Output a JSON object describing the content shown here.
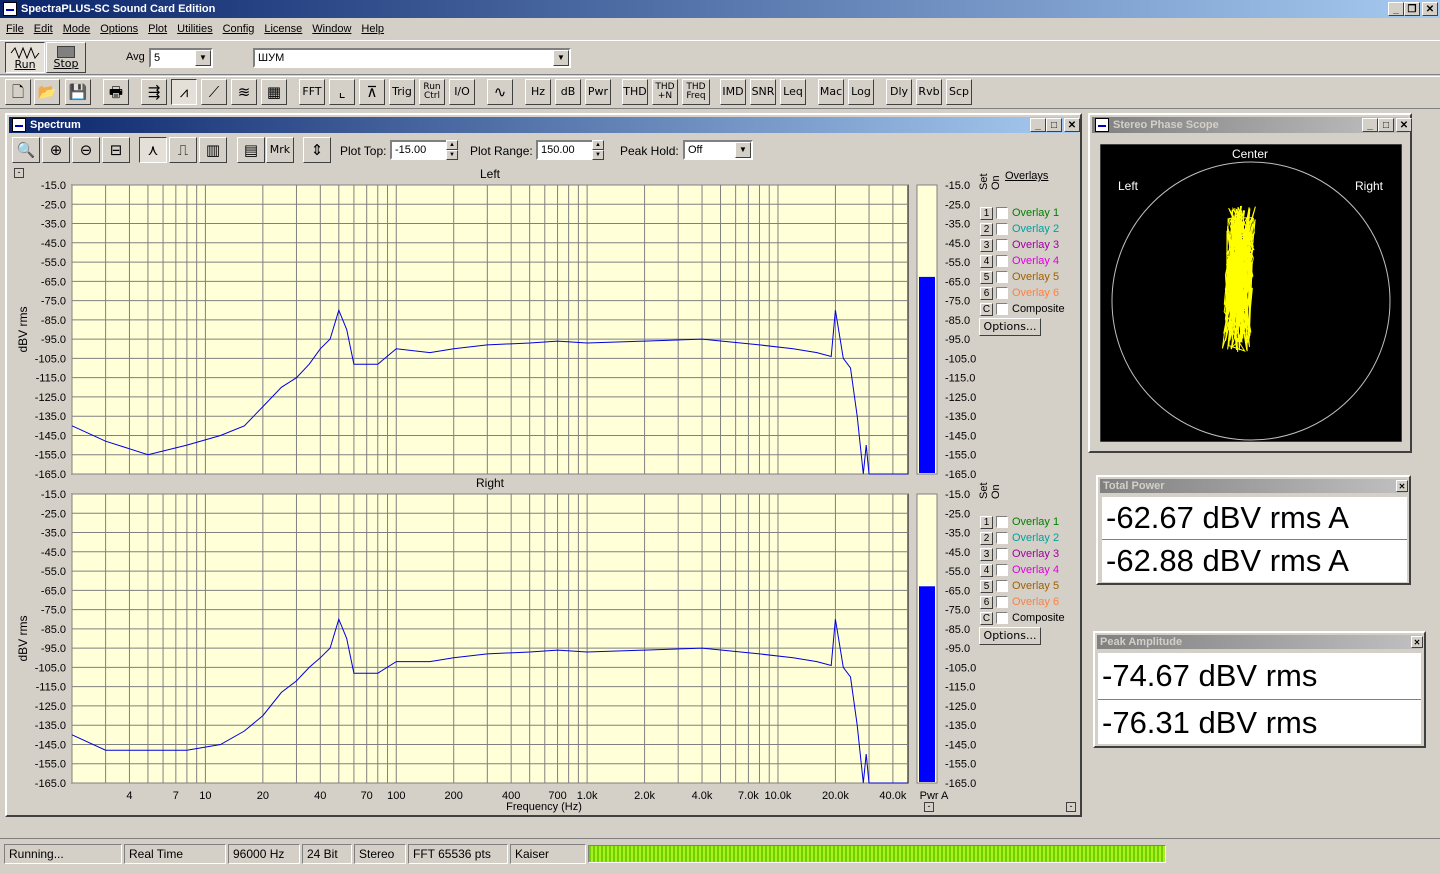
{
  "window": {
    "title": "SpectraPLUS-SC Sound Card Edition"
  },
  "menu": [
    "File",
    "Edit",
    "Mode",
    "Options",
    "Plot",
    "Utilities",
    "Config",
    "License",
    "Window",
    "Help"
  ],
  "toolbar1": {
    "run_label": "Run",
    "stop_label": "Stop",
    "avg_label": "Avg",
    "avg_value": "5",
    "preset_value": "ШУМ"
  },
  "toolbar2": {
    "fft": "FFT",
    "trig": "Trig",
    "run_ctrl_1": "Run",
    "run_ctrl_2": "Ctrl",
    "io": "I/O",
    "hz": "Hz",
    "db": "dB",
    "pwr": "Pwr",
    "thd": "THD",
    "thdn_1": "THD",
    "thdn_2": "+N",
    "thdf_1": "THD",
    "thdf_2": "Freq",
    "imd": "IMD",
    "snr": "SNR",
    "leq": "Leq",
    "mac": "Mac",
    "log": "Log",
    "dly": "Dly",
    "rvb": "Rvb",
    "scp": "Scp"
  },
  "spectrum": {
    "title": "Spectrum",
    "mrk": "Mrk",
    "plot_top_label": "Plot Top:",
    "plot_top_value": "-15.00",
    "plot_range_label": "Plot Range:",
    "plot_range_value": "150.00",
    "peak_hold_label": "Peak Hold:",
    "peak_hold_value": "Off",
    "left_title": "Left",
    "right_title": "Right",
    "ylabel": "dBV rms",
    "xlabel": "Frequency (Hz)",
    "pwr_a": "Pwr A",
    "y_ticks": [
      "-15.0",
      "-25.0",
      "-35.0",
      "-45.0",
      "-55.0",
      "-65.0",
      "-75.0",
      "-85.0",
      "-95.0",
      "-105.0",
      "-115.0",
      "-125.0",
      "-135.0",
      "-145.0",
      "-155.0",
      "-165.0"
    ],
    "x_ticks": [
      {
        "label": "4",
        "f": 4
      },
      {
        "label": "7",
        "f": 7
      },
      {
        "label": "10",
        "f": 10
      },
      {
        "label": "20",
        "f": 20
      },
      {
        "label": "40",
        "f": 40
      },
      {
        "label": "70",
        "f": 70
      },
      {
        "label": "100",
        "f": 100
      },
      {
        "label": "200",
        "f": 200
      },
      {
        "label": "400",
        "f": 400
      },
      {
        "label": "700",
        "f": 700
      },
      {
        "label": "1.0k",
        "f": 1000
      },
      {
        "label": "2.0k",
        "f": 2000
      },
      {
        "label": "4.0k",
        "f": 4000
      },
      {
        "label": "7.0k",
        "f": 7000
      },
      {
        "label": "10.0k",
        "f": 10000
      },
      {
        "label": "20.0k",
        "f": 20000
      },
      {
        "label": "40.0k",
        "f": 40000
      }
    ],
    "overlays_label": "Overlays",
    "set_label": "Set",
    "on_label": "On",
    "overlays": [
      {
        "num": "1",
        "label": "Overlay 1",
        "color": "#008000"
      },
      {
        "num": "2",
        "label": "Overlay 2",
        "color": "#00a0a0"
      },
      {
        "num": "3",
        "label": "Overlay 3",
        "color": "#a000a0"
      },
      {
        "num": "4",
        "label": "Overlay 4",
        "color": "#e000e0"
      },
      {
        "num": "5",
        "label": "Overlay 5",
        "color": "#a06000"
      },
      {
        "num": "6",
        "label": "Overlay 6",
        "color": "#ff8040"
      },
      {
        "num": "C",
        "label": "Composite",
        "color": "#000000"
      }
    ],
    "options_label": "Options...",
    "bar_level_left_dbv": -62.7,
    "bar_level_right_dbv": -62.9
  },
  "phase_scope": {
    "title": "Stereo Phase Scope",
    "center": "Center",
    "left": "Left",
    "right": "Right"
  },
  "total_power": {
    "title": "Total Power",
    "left_value": "-62.67 dBV rms A",
    "right_value": "-62.88 dBV rms A"
  },
  "peak_amplitude": {
    "title": "Peak Amplitude",
    "left_value": "-74.67 dBV rms",
    "right_value": "-76.31 dBV rms"
  },
  "status": {
    "state": "Running...",
    "mode": "Real Time",
    "rate": "96000 Hz",
    "bits": "24 Bit",
    "channels": "Stereo",
    "fft": "FFT 65536 pts",
    "window": "Kaiser"
  },
  "chart_data": [
    {
      "type": "line",
      "title": "Left",
      "xlabel": "Frequency (Hz)",
      "ylabel": "dBV rms",
      "x_scale": "log",
      "xlim": [
        2,
        48000
      ],
      "ylim": [
        -165,
        -15
      ],
      "grid": true,
      "series": [
        {
          "x": [
            2,
            3,
            5,
            8,
            12,
            16,
            20,
            25,
            30,
            35,
            40,
            45,
            50,
            55,
            60,
            80,
            100,
            150,
            200,
            300,
            500,
            700,
            1000,
            2000,
            4000,
            8000,
            12000,
            16000,
            19000,
            20000,
            22000,
            24000,
            26000,
            28000,
            29000,
            30000,
            48000
          ],
          "y": [
            -140,
            -148,
            -155,
            -150,
            -145,
            -140,
            -130,
            -120,
            -115,
            -108,
            -100,
            -95,
            -80,
            -90,
            -108,
            -108,
            -100,
            -102,
            -100,
            -98,
            -97,
            -96,
            -97,
            -96,
            -95,
            -98,
            -100,
            -102,
            -104,
            -80,
            -105,
            -110,
            -135,
            -165,
            -150,
            -165,
            -165
          ]
        }
      ]
    },
    {
      "type": "line",
      "title": "Right",
      "xlabel": "Frequency (Hz)",
      "ylabel": "dBV rms",
      "x_scale": "log",
      "xlim": [
        2,
        48000
      ],
      "ylim": [
        -165,
        -15
      ],
      "grid": true,
      "series": [
        {
          "x": [
            2,
            3,
            5,
            8,
            12,
            16,
            20,
            25,
            30,
            35,
            40,
            45,
            50,
            55,
            60,
            80,
            100,
            150,
            200,
            300,
            500,
            700,
            1000,
            2000,
            4000,
            8000,
            12000,
            16000,
            19000,
            20000,
            22000,
            24000,
            26000,
            28000,
            29000,
            30000,
            48000
          ],
          "y": [
            -140,
            -148,
            -148,
            -148,
            -145,
            -138,
            -130,
            -118,
            -112,
            -105,
            -100,
            -95,
            -80,
            -90,
            -108,
            -108,
            -102,
            -102,
            -100,
            -98,
            -97,
            -96,
            -97,
            -96,
            -95,
            -98,
            -100,
            -102,
            -104,
            -80,
            -105,
            -110,
            -135,
            -165,
            -150,
            -165,
            -165
          ]
        }
      ]
    }
  ]
}
